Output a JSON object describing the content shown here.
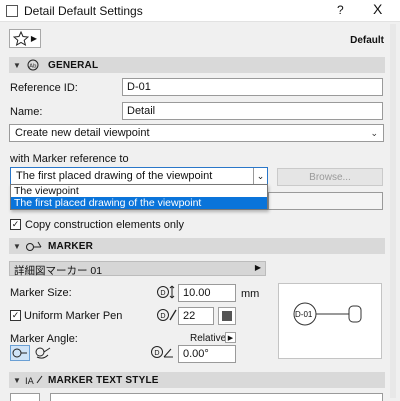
{
  "window": {
    "title": "Detail Default Settings",
    "help_glyph": "?",
    "close_glyph": "X"
  },
  "toolbar": {
    "favorites_icon": "star-icon",
    "default_label": "Default"
  },
  "general": {
    "title": "GENERAL",
    "reference_id_label": "Reference ID:",
    "reference_id_value": "D-01",
    "name_label": "Name:",
    "name_value": "Detail",
    "action_select": "Create new detail viewpoint",
    "marker_ref_label": "with Marker reference to",
    "marker_ref_select": "The first placed drawing of the viewpoint",
    "marker_ref_options": [
      "The viewpoint",
      "The first placed drawing of the viewpoint"
    ],
    "browse_label": "Browse...",
    "copy_label": "Copy construction elements only",
    "copy_checked": true
  },
  "marker": {
    "title": "MARKER",
    "marker_type": "詳細図マーカー 01",
    "size_label": "Marker Size:",
    "size_value": "10.00",
    "size_unit": "mm",
    "uniform_pen_label": "Uniform Marker Pen",
    "uniform_pen_checked": true,
    "pen_value": "22",
    "angle_label": "Marker Angle:",
    "relative_label": "Relative",
    "angle_value": "0.00°",
    "preview_text": "D-01"
  },
  "marker_text_style": {
    "title": "MARKER TEXT STYLE"
  }
}
